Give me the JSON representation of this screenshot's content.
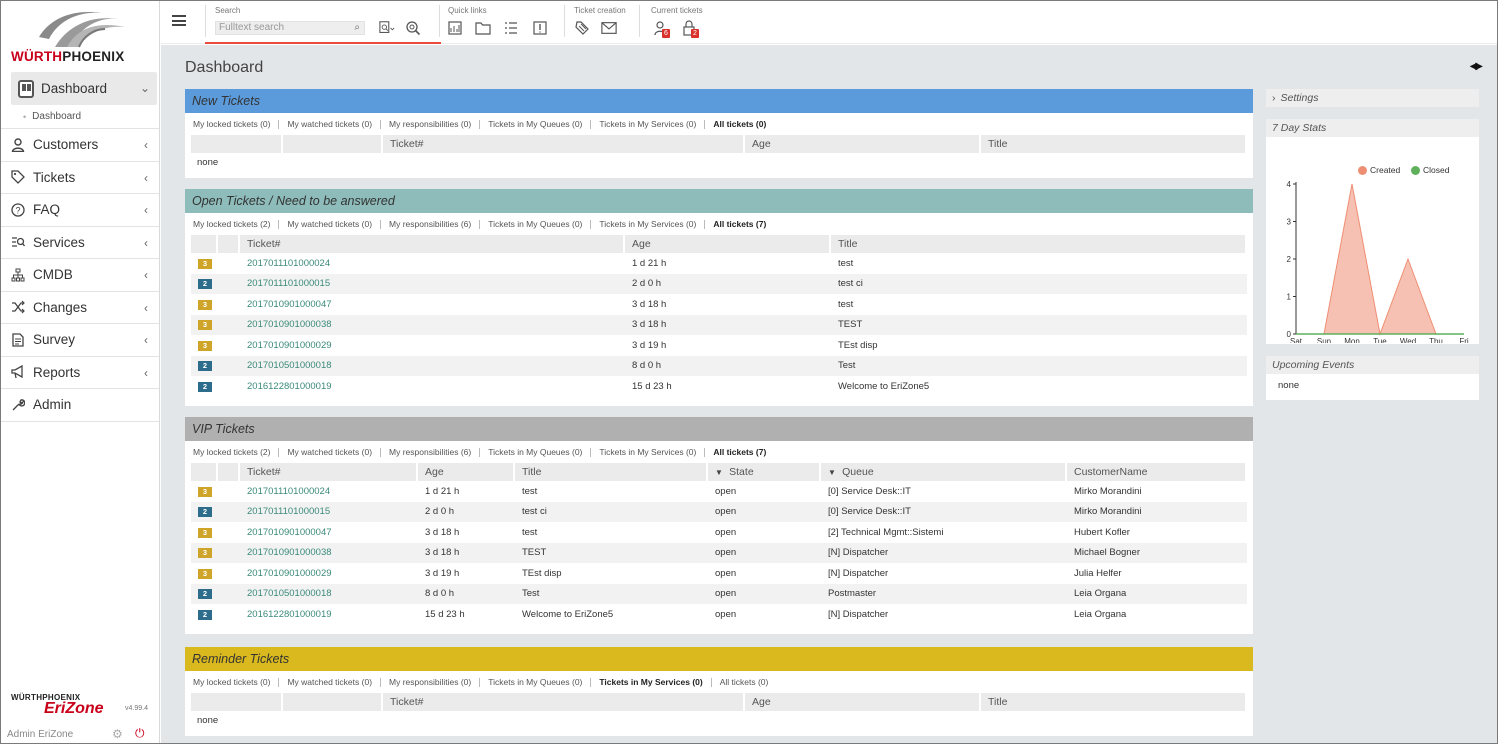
{
  "brand": {
    "logo_text_1": "WÜRTH",
    "logo_text_2": "PHOENIX",
    "product": "EriZone",
    "version": "v4.99.4",
    "small_1": "WÜRTH",
    "small_2": "PHOENIX"
  },
  "user": {
    "name": "Admin EriZone"
  },
  "sidebar": {
    "items": [
      {
        "label": "Dashboard",
        "icon": "dashboard-icon"
      },
      {
        "label": "Customers",
        "icon": "user-icon"
      },
      {
        "label": "Tickets",
        "icon": "tag-icon"
      },
      {
        "label": "FAQ",
        "icon": "question-icon"
      },
      {
        "label": "Services",
        "icon": "services-icon"
      },
      {
        "label": "CMDB",
        "icon": "sitemap-icon"
      },
      {
        "label": "Changes",
        "icon": "shuffle-icon"
      },
      {
        "label": "Survey",
        "icon": "document-icon"
      },
      {
        "label": "Reports",
        "icon": "megaphone-icon"
      },
      {
        "label": "Admin",
        "icon": "wrench-icon"
      }
    ],
    "sub_dashboard": "Dashboard"
  },
  "toolbar": {
    "search_label": "Search",
    "search_placeholder": "Fulltext search",
    "quick_links_label": "Quick links",
    "ticket_creation_label": "Ticket creation",
    "current_tickets_label": "Current tickets",
    "badge_locked": "6",
    "badge_watched": "2"
  },
  "page": {
    "title": "Dashboard"
  },
  "widgets": {
    "new_tickets": {
      "title": "New Tickets",
      "color": "#5b9bdb",
      "filters": [
        "My locked tickets (0)",
        "My watched tickets (0)",
        "My responsibilities (0)",
        "Tickets in My Queues (0)",
        "Tickets in My Services (0)",
        "All tickets (0)"
      ],
      "columns": [
        "",
        "",
        "Ticket#",
        "Age",
        "Title"
      ],
      "empty": "none"
    },
    "open_tickets": {
      "title": "Open Tickets / Need to be answered",
      "color": "#8dbcba",
      "filters": [
        "My locked tickets (2)",
        "My watched tickets (0)",
        "My responsibilities (6)",
        "Tickets in My Queues (0)",
        "Tickets in My Services (0)",
        "All tickets (7)"
      ],
      "columns": [
        "",
        "",
        "Ticket#",
        "Age",
        "Title"
      ],
      "rows": [
        {
          "prio": "3",
          "ticket": "2017011101000024",
          "age": "1 d 21 h",
          "title": "test"
        },
        {
          "prio": "2",
          "ticket": "2017011101000015",
          "age": "2 d 0 h",
          "title": "test ci"
        },
        {
          "prio": "3",
          "ticket": "2017010901000047",
          "age": "3 d 18 h",
          "title": "test"
        },
        {
          "prio": "3",
          "ticket": "2017010901000038",
          "age": "3 d 18 h",
          "title": "TEST"
        },
        {
          "prio": "3",
          "ticket": "2017010901000029",
          "age": "3 d 19 h",
          "title": "TEst disp"
        },
        {
          "prio": "2",
          "ticket": "2017010501000018",
          "age": "8 d 0 h",
          "title": "Test"
        },
        {
          "prio": "2",
          "ticket": "2016122801000019",
          "age": "15 d 23 h",
          "title": "Welcome to EriZone5"
        }
      ]
    },
    "vip_tickets": {
      "title": "VIP Tickets",
      "color": "#b0b0b0",
      "filters": [
        "My locked tickets (2)",
        "My watched tickets (0)",
        "My responsibilities (6)",
        "Tickets in My Queues (0)",
        "Tickets in My Services (0)",
        "All tickets (7)"
      ],
      "columns": [
        "",
        "",
        "Ticket#",
        "Age",
        "Title",
        "State",
        "Queue",
        "CustomerName"
      ],
      "rows": [
        {
          "prio": "3",
          "ticket": "2017011101000024",
          "age": "1 d 21 h",
          "title": "test",
          "state": "open",
          "queue": "[0] Service Desk::IT",
          "customer": "Mirko Morandini"
        },
        {
          "prio": "2",
          "ticket": "2017011101000015",
          "age": "2 d 0 h",
          "title": "test ci",
          "state": "open",
          "queue": "[0] Service Desk::IT",
          "customer": "Mirko Morandini"
        },
        {
          "prio": "3",
          "ticket": "2017010901000047",
          "age": "3 d 18 h",
          "title": "test",
          "state": "open",
          "queue": "[2] Technical Mgmt::Sistemi",
          "customer": "Hubert Kofler"
        },
        {
          "prio": "3",
          "ticket": "2017010901000038",
          "age": "3 d 18 h",
          "title": "TEST",
          "state": "open",
          "queue": "[N] Dispatcher",
          "customer": "Michael Bogner"
        },
        {
          "prio": "3",
          "ticket": "2017010901000029",
          "age": "3 d 19 h",
          "title": "TEst disp",
          "state": "open",
          "queue": "[N] Dispatcher",
          "customer": "Julia Helfer"
        },
        {
          "prio": "2",
          "ticket": "2017010501000018",
          "age": "8 d 0 h",
          "title": "Test",
          "state": "open",
          "queue": "Postmaster",
          "customer": "Leia Organa"
        },
        {
          "prio": "2",
          "ticket": "2016122801000019",
          "age": "15 d 23 h",
          "title": "Welcome to EriZone5",
          "state": "open",
          "queue": "[N] Dispatcher",
          "customer": "Leia Organa"
        }
      ]
    },
    "reminder_tickets": {
      "title": "Reminder Tickets",
      "color": "#d9b91e",
      "filters": [
        "My locked tickets (0)",
        "My watched tickets (0)",
        "My responsibilities (0)",
        "Tickets in My Queues (0)",
        "Tickets in My Services (0)",
        "All tickets (0)"
      ],
      "columns": [
        "",
        "",
        "Ticket#",
        "Age",
        "Title"
      ],
      "empty": "none"
    }
  },
  "right": {
    "settings": "Settings",
    "stats_title": "7 Day Stats",
    "upcoming_title": "Upcoming Events",
    "upcoming_empty": "none"
  },
  "chart_data": {
    "type": "area",
    "categories": [
      "Sat",
      "Sun",
      "Mon",
      "Tue",
      "Wed",
      "Thu",
      "Fri"
    ],
    "series": [
      {
        "name": "Created",
        "values": [
          0,
          0,
          4,
          0,
          2,
          0,
          0
        ],
        "color": "#ee8e73"
      },
      {
        "name": "Closed",
        "values": [
          0,
          0,
          0,
          0,
          0,
          0,
          0
        ],
        "color": "#5fb05a"
      }
    ],
    "yticks": [
      "0",
      "1",
      "2",
      "3",
      "4"
    ],
    "ylim": [
      0,
      4
    ],
    "legend": "top-right"
  }
}
